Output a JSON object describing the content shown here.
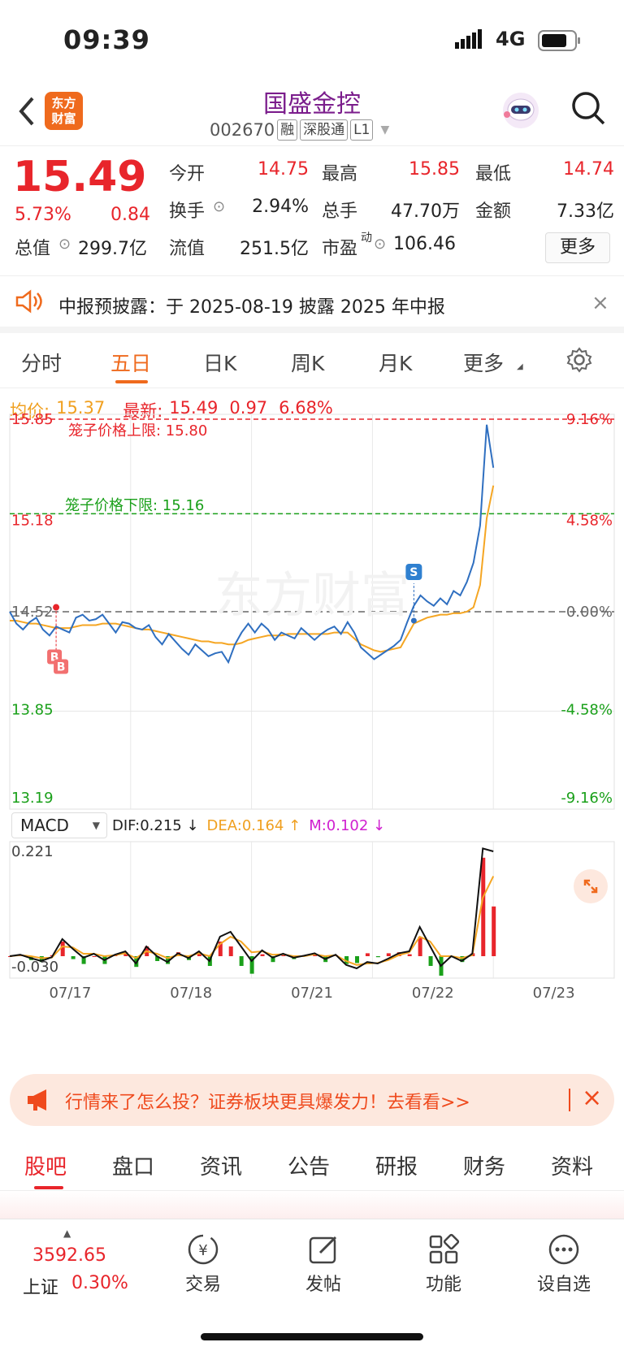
{
  "status": {
    "time": "09:39",
    "network": "4G"
  },
  "header": {
    "logo_line1": "东方",
    "logo_line2": "财富",
    "name": "国盛金控",
    "code": "002670",
    "tags": [
      "融",
      "深股通",
      "L1"
    ]
  },
  "quote": {
    "price": "15.49",
    "change_pct": "5.73%",
    "change": "0.84",
    "fields": [
      {
        "label": "今开",
        "value": "14.75",
        "color": "red"
      },
      {
        "label": "最高",
        "value": "15.85",
        "color": "red"
      },
      {
        "label": "最低",
        "value": "14.74",
        "color": "red"
      },
      {
        "label": "换手",
        "value": "2.94%",
        "color": ""
      },
      {
        "label": "总手",
        "value": "47.70万",
        "color": ""
      },
      {
        "label": "金额",
        "value": "7.33亿",
        "color": ""
      },
      {
        "label": "总值",
        "value": "299.7亿",
        "color": ""
      },
      {
        "label": "流值",
        "value": "251.5亿",
        "color": ""
      },
      {
        "label": "市盈",
        "value": "106.46",
        "color": ""
      }
    ],
    "pe_sup": "动",
    "more_label": "更多"
  },
  "notice": {
    "text": "中报预披露：于 2025-08-19 披露 2025 年中报"
  },
  "tabs": [
    "分时",
    "五日",
    "日K",
    "周K",
    "月K",
    "更多"
  ],
  "active_tab": "五日",
  "chart_info": {
    "avg_label": "均价:",
    "avg_value": "15.37",
    "latest_label": "最新:",
    "latest_value": "15.49",
    "latest_change": "0.97",
    "latest_pct": "6.68%"
  },
  "chart_data": {
    "type": "line",
    "y_labels_left": [
      "15.85",
      "15.18",
      "14.52",
      "13.85",
      "13.19"
    ],
    "y_labels_right": [
      "9.16%",
      "4.58%",
      "0.00%",
      "-4.58%",
      "-9.16%"
    ],
    "ylim": [
      13.19,
      15.85
    ],
    "annotations": [
      {
        "text": "笼子价格上限: 15.80",
        "value": 15.8,
        "color": "#e8252b"
      },
      {
        "text": "笼子价格下限: 15.16",
        "value": 15.16,
        "color": "#1aa01a"
      }
    ],
    "markers": [
      "B",
      "B",
      "S"
    ],
    "x_labels": [
      "07/17",
      "07/18",
      "07/21",
      "07/22",
      "07/23"
    ],
    "series": [
      {
        "values": [
          14.52,
          14.44,
          14.4,
          14.45,
          14.48,
          14.4,
          14.36,
          14.42,
          14.4,
          14.38,
          14.48,
          14.5,
          14.46,
          14.47,
          14.5,
          14.44,
          14.38,
          14.45,
          14.44,
          14.41,
          14.4,
          14.43,
          14.35,
          14.3,
          14.37,
          14.32,
          14.27,
          14.23,
          14.3,
          14.26,
          14.22,
          14.24,
          14.25,
          14.18,
          14.3,
          14.38,
          14.44,
          14.38,
          14.44,
          14.4,
          14.33,
          14.38,
          14.36,
          14.34,
          14.41,
          14.37,
          14.33,
          14.37,
          14.4,
          14.42,
          14.37,
          14.45,
          14.38,
          14.28,
          14.24,
          14.2,
          14.23,
          14.26,
          14.29,
          14.33,
          14.45,
          14.56,
          14.63,
          14.59,
          14.56,
          14.61,
          14.57,
          14.66,
          14.63,
          14.72,
          14.85,
          15.1,
          15.78,
          15.49
        ]
      },
      {
        "values": [
          14.46,
          14.46,
          14.45,
          14.44,
          14.44,
          14.43,
          14.42,
          14.41,
          14.41,
          14.41,
          14.42,
          14.43,
          14.43,
          14.43,
          14.44,
          14.44,
          14.44,
          14.43,
          14.42,
          14.41,
          14.4,
          14.4,
          14.39,
          14.38,
          14.37,
          14.36,
          14.35,
          14.34,
          14.33,
          14.32,
          14.32,
          14.31,
          14.31,
          14.3,
          14.3,
          14.31,
          14.33,
          14.34,
          14.35,
          14.36,
          14.36,
          14.36,
          14.37,
          14.37,
          14.37,
          14.37,
          14.37,
          14.37,
          14.37,
          14.38,
          14.38,
          14.38,
          14.34,
          14.3,
          14.28,
          14.26,
          14.25,
          14.26,
          14.27,
          14.28,
          14.36,
          14.44,
          14.46,
          14.48,
          14.49,
          14.5,
          14.5,
          14.51,
          14.51,
          14.52,
          14.55,
          14.7,
          15.15,
          15.37
        ]
      }
    ],
    "macd": {
      "label": "MACD",
      "dif_label": "DIF:0.215",
      "dea_label": "DEA:0.164",
      "m_label": "M:0.102",
      "y_labels": [
        "0.221",
        "-0.030"
      ],
      "dif": [
        0.0,
        0.003,
        -0.004,
        -0.01,
        -0.002,
        0.035,
        0.015,
        -0.003,
        0.005,
        -0.008,
        0.003,
        0.01,
        -0.015,
        0.02,
        0.0,
        -0.012,
        0.006,
        -0.004,
        0.01,
        -0.01,
        0.04,
        0.05,
        0.02,
        -0.01,
        0.012,
        -0.003,
        0.005,
        -0.003,
        0.001,
        0.006,
        -0.006,
        0.003,
        -0.018,
        -0.025,
        -0.012,
        -0.015,
        -0.005,
        0.006,
        0.01,
        0.06,
        0.02,
        -0.02,
        0.0,
        -0.01,
        0.005,
        0.221,
        0.215
      ],
      "dea": [
        0.0,
        0.002,
        0.0,
        -0.004,
        -0.003,
        0.02,
        0.018,
        0.005,
        0.005,
        0.0,
        0.002,
        0.006,
        -0.004,
        0.01,
        0.005,
        -0.004,
        0.002,
        0.0,
        0.006,
        0.0,
        0.025,
        0.04,
        0.03,
        0.008,
        0.01,
        0.003,
        0.004,
        0.0,
        0.0,
        0.004,
        0.0,
        0.002,
        -0.01,
        -0.018,
        -0.015,
        -0.014,
        -0.008,
        0.002,
        0.008,
        0.04,
        0.03,
        0.0,
        0.0,
        -0.004,
        0.002,
        0.12,
        0.164
      ]
    }
  },
  "banner": {
    "text": "行情来了怎么投？证券板块更具爆发力！去看看>>"
  },
  "bottom_tabs": [
    "股吧",
    "盘口",
    "资讯",
    "公告",
    "研报",
    "财务",
    "资料"
  ],
  "bottom_nav": {
    "index_value": "3592.65",
    "index_name": "上证",
    "index_pct": "0.30%",
    "buttons": [
      "交易",
      "发帖",
      "功能",
      "设自选"
    ]
  }
}
